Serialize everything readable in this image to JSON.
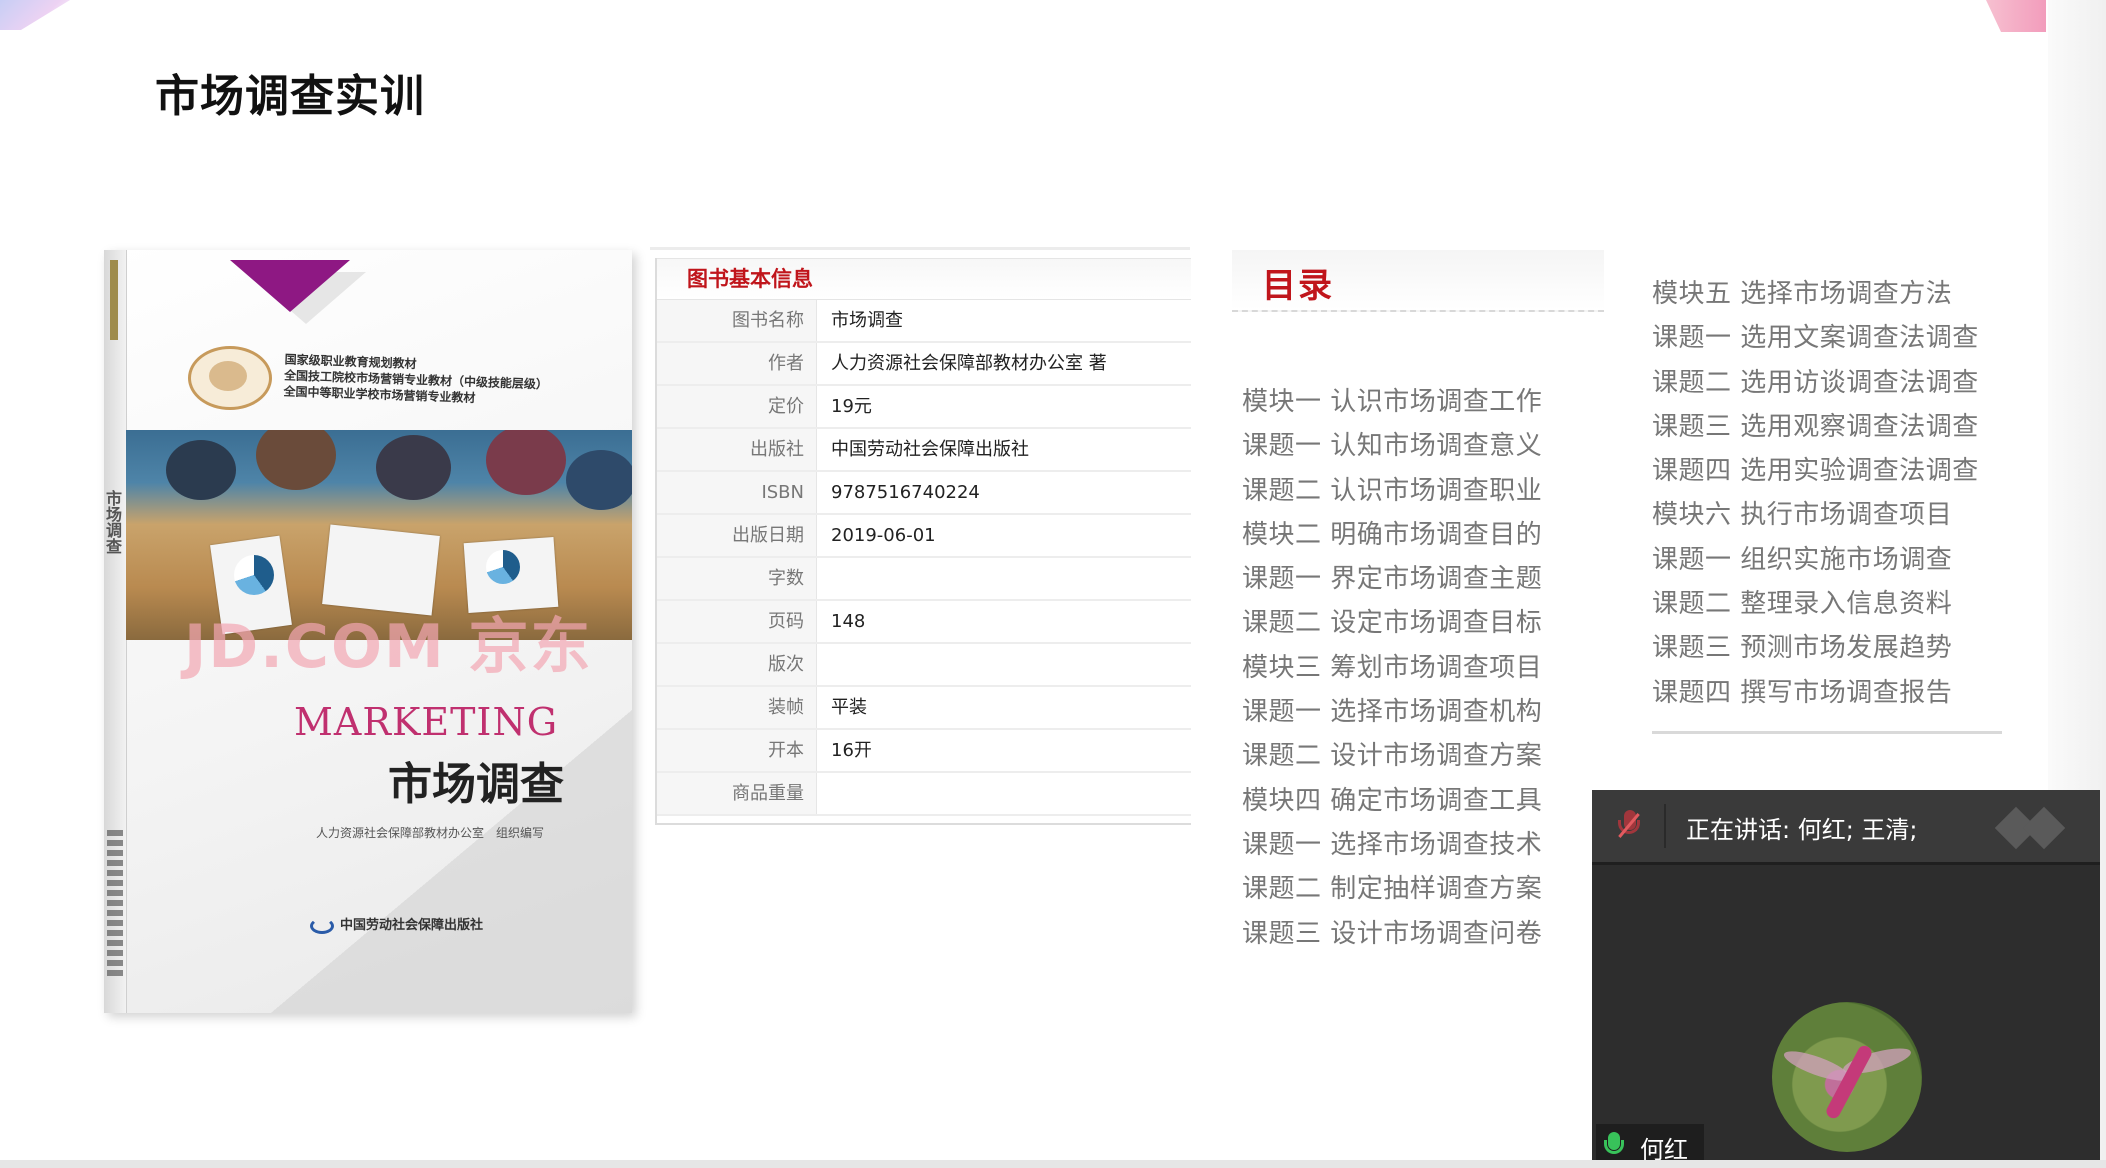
{
  "slide": {
    "title": "市场调查实训"
  },
  "book": {
    "spine_title": "市场调查",
    "series_lines": [
      "国家级职业教育规划教材",
      "全国技工院校市场营销专业教材（中级技能层级）",
      "全国中等职业学校市场营销专业教材"
    ],
    "watermark": "JD.COM 京东",
    "title_en": "MARKETING",
    "title_cn": "市场调查",
    "editor": "人力资源社会保障部教材办公室　组织编写",
    "publisher": "中国劳动社会保障出版社"
  },
  "info_table": {
    "header": "图书基本信息",
    "rows": [
      {
        "label": "图书名称",
        "value": "市场调查"
      },
      {
        "label": "作者",
        "value": "人力资源社会保障部教材办公室 著"
      },
      {
        "label": "定价",
        "value": "19元"
      },
      {
        "label": "出版社",
        "value": "中国劳动社会保障出版社"
      },
      {
        "label": "ISBN",
        "value": "9787516740224"
      },
      {
        "label": "出版日期",
        "value": "2019-06-01"
      },
      {
        "label": "字数",
        "value": ""
      },
      {
        "label": "页码",
        "value": "148"
      },
      {
        "label": "版次",
        "value": ""
      },
      {
        "label": "装帧",
        "value": "平装"
      },
      {
        "label": "开本",
        "value": "16开"
      },
      {
        "label": "商品重量",
        "value": ""
      }
    ]
  },
  "toc": {
    "title": "目录",
    "col1": [
      "模块一 认识市场调查工作",
      "课题一 认知市场调查意义",
      "课题二 认识市场调查职业",
      "模块二 明确市场调查目的",
      "课题一 界定市场调查主题",
      "课题二 设定市场调查目标",
      "模块三 筹划市场调查项目",
      "课题一 选择市场调查机构",
      "课题二 设计市场调查方案",
      "模块四 确定市场调查工具",
      "课题一 选择市场调查技术",
      "课题二 制定抽样调查方案",
      "课题三 设计市场调查问卷"
    ],
    "col2": [
      "模块五 选择市场调查方法",
      "课题一 选用文案调查法调查",
      "课题二 选用访谈调查法调查",
      "课题三 选用观察调查法调查",
      "课题四 选用实验调查法调查",
      "模块六 执行市场调查项目",
      "课题一 组织实施市场调查",
      "课题二 整理录入信息资料",
      "课题三 预测市场发展趋势",
      "课题四 撰写市场调查报告"
    ]
  },
  "meeting": {
    "speaking_text": "正在讲话: 何红; 王清;",
    "participant_name": "何红",
    "mic_state": "muted",
    "colors": {
      "mute_red": "#a1363c",
      "mic_green": "#38c25a"
    }
  },
  "colors": {
    "accent_red": "#c0151b",
    "cover_magenta": "#8e1883"
  }
}
